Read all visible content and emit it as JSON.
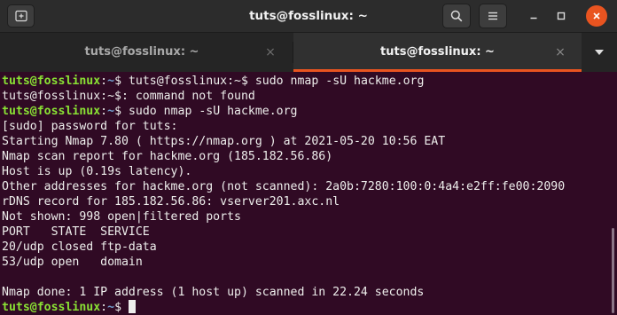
{
  "window": {
    "title": "tuts@fosslinux: ~",
    "new_tab_icon": "new-tab-icon",
    "search_icon": "search-icon",
    "menu_icon": "hamburger-menu-icon",
    "minimize_icon": "minimize-icon",
    "maximize_icon": "maximize-icon",
    "close_icon": "close-icon",
    "close_color": "#e95420"
  },
  "tabs": [
    {
      "label": "tuts@fosslinux: ~",
      "active": false
    },
    {
      "label": "tuts@fosslinux: ~",
      "active": true
    }
  ],
  "tab_close_glyph": "×",
  "tab_menu_icon": "dropdown-arrow-icon",
  "terminal": {
    "colors": {
      "background": "#300a24",
      "text": "#eeeeec",
      "prompt_user": "#8ae234",
      "prompt_path": "#729fcf"
    },
    "lines": [
      {
        "user": "tuts@fosslinux",
        "sep": ":",
        "path": "~",
        "text": "$ tuts@fosslinux:~$ sudo nmap -sU hackme.org"
      },
      {
        "text": "tuts@fosslinux:~$: command not found"
      },
      {
        "user": "tuts@fosslinux",
        "sep": ":",
        "path": "~",
        "text": "$ sudo nmap -sU hackme.org"
      },
      {
        "text": "[sudo] password for tuts:"
      },
      {
        "text": "Starting Nmap 7.80 ( https://nmap.org ) at 2021-05-20 10:56 EAT"
      },
      {
        "text": "Nmap scan report for hackme.org (185.182.56.86)"
      },
      {
        "text": "Host is up (0.19s latency)."
      },
      {
        "text": "Other addresses for hackme.org (not scanned): 2a0b:7280:100:0:4a4:e2ff:fe00:2090"
      },
      {
        "text": "rDNS record for 185.182.56.86: vserver201.axc.nl"
      },
      {
        "text": "Not shown: 998 open|filtered ports"
      },
      {
        "text": "PORT   STATE  SERVICE"
      },
      {
        "text": "20/udp closed ftp-data"
      },
      {
        "text": "53/udp open   domain"
      },
      {
        "text": ""
      },
      {
        "text": "Nmap done: 1 IP address (1 host up) scanned in 22.24 seconds"
      },
      {
        "user": "tuts@fosslinux",
        "sep": ":",
        "path": "~",
        "text": "$ ",
        "cursor": true
      }
    ]
  }
}
